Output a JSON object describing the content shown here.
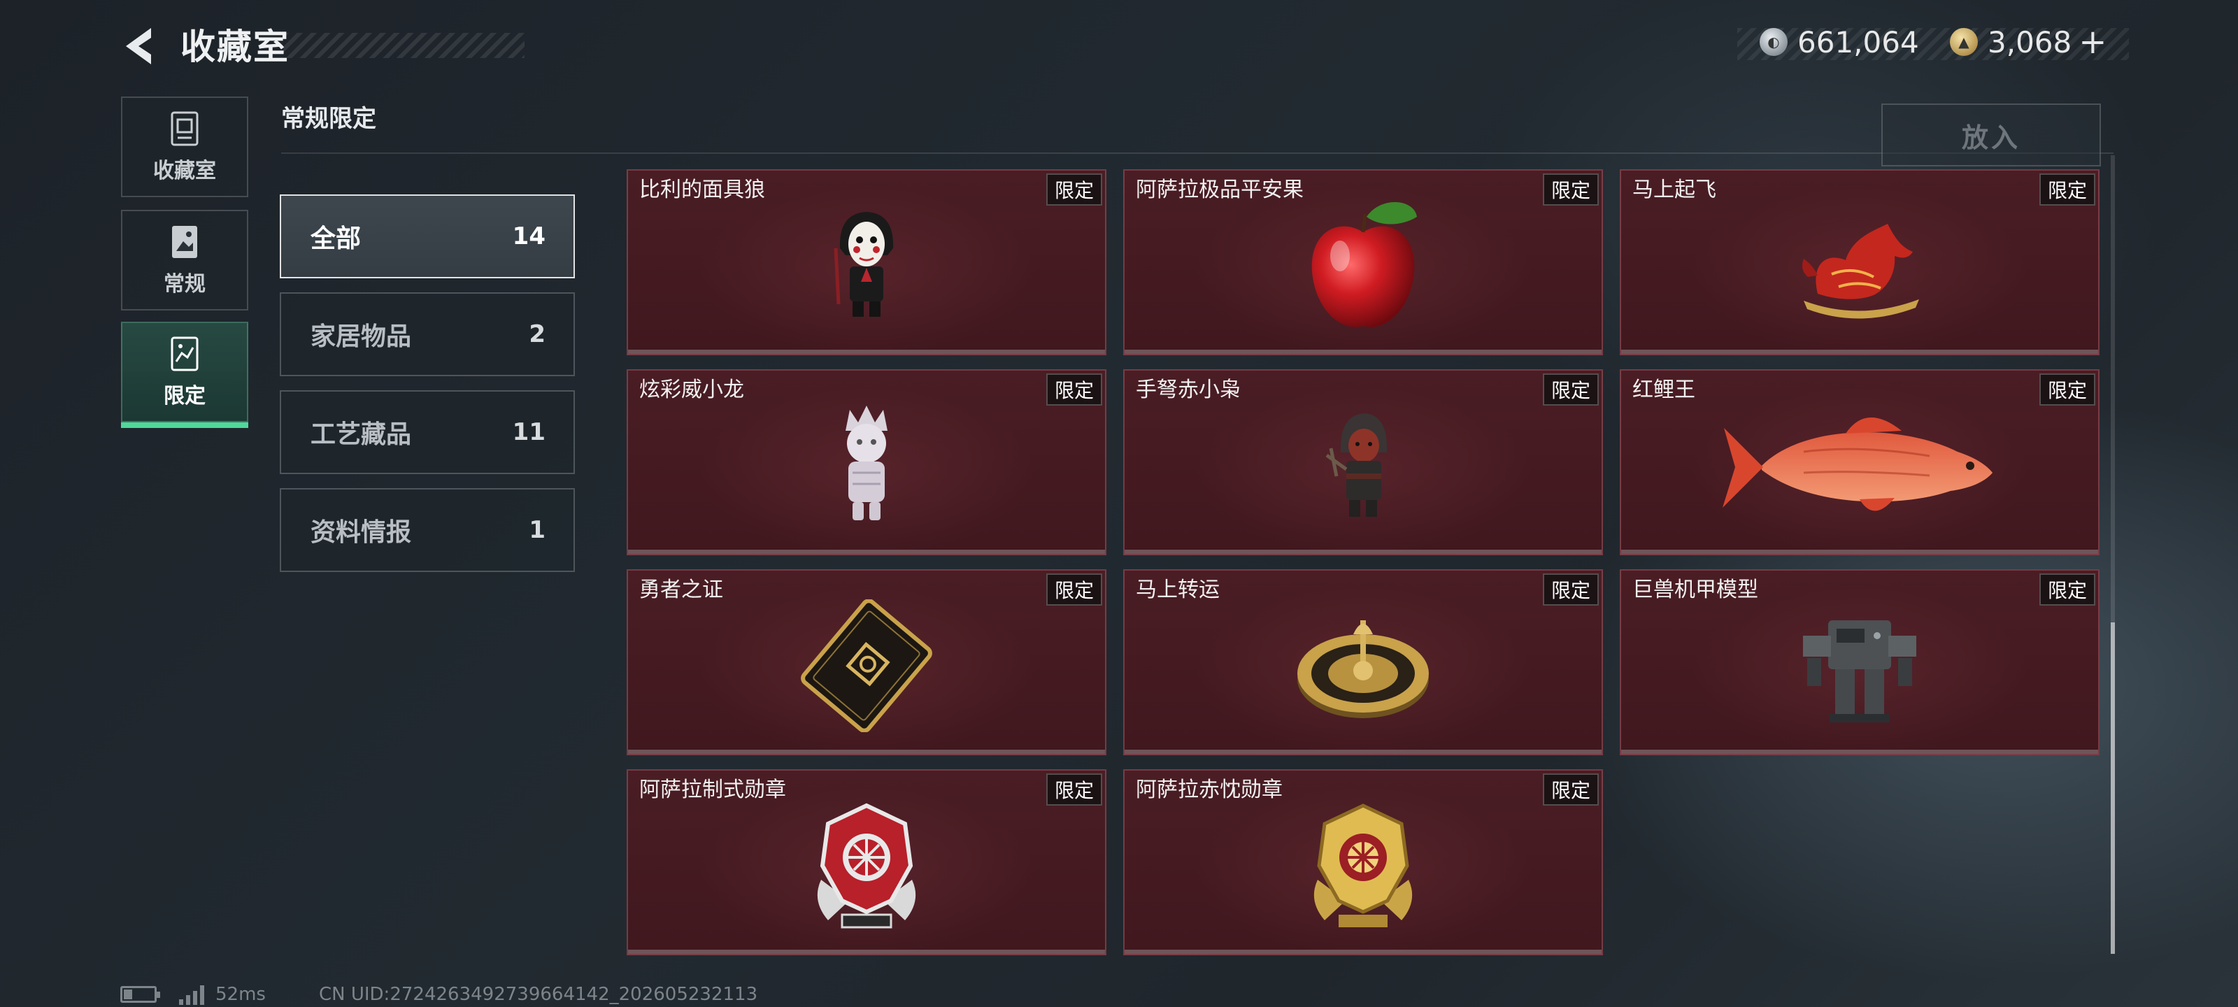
{
  "header": {
    "title": "收藏室",
    "currency_silver": "661,064",
    "currency_gold": "3,068",
    "plus": "+"
  },
  "nav": [
    {
      "label": "收藏室",
      "icon": "collection-icon"
    },
    {
      "label": "常规",
      "icon": "regular-icon"
    },
    {
      "label": "限定",
      "icon": "limited-icon",
      "active": true
    }
  ],
  "section": {
    "title": "常规限定",
    "put_button": "放入"
  },
  "categories": [
    {
      "name": "全部",
      "count": "14",
      "active": true
    },
    {
      "name": "家居物品",
      "count": "2"
    },
    {
      "name": "工艺藏品",
      "count": "11"
    },
    {
      "name": "资料情报",
      "count": "1"
    }
  ],
  "items": [
    {
      "name": "比利的面具狼",
      "tag": "限定",
      "icon": "puppet-figure-icon"
    },
    {
      "name": "阿萨拉极品平安果",
      "tag": "限定",
      "icon": "apple-icon"
    },
    {
      "name": "马上起飞",
      "tag": "限定",
      "icon": "red-horse-icon"
    },
    {
      "name": "炫彩威小龙",
      "tag": "限定",
      "icon": "white-figure-icon"
    },
    {
      "name": "手弩赤小枭",
      "tag": "限定",
      "icon": "hooded-figure-icon"
    },
    {
      "name": "红鲤王",
      "tag": "限定",
      "icon": "red-carp-icon"
    },
    {
      "name": "勇者之证",
      "tag": "限定",
      "icon": "card-icon"
    },
    {
      "name": "马上转运",
      "tag": "限定",
      "icon": "golden-compass-icon"
    },
    {
      "name": "巨兽机甲模型",
      "tag": "限定",
      "icon": "mech-model-icon"
    },
    {
      "name": "阿萨拉制式勋章",
      "tag": "限定",
      "icon": "red-medal-icon"
    },
    {
      "name": "阿萨拉赤忱勋章",
      "tag": "限定",
      "icon": "gold-medal-icon"
    }
  ],
  "footer": {
    "ping": "52ms",
    "uid": "CN UID:2724263492739664142_202605232113"
  },
  "colors": {
    "accent_green": "#4fd89a",
    "card_bg": "#4a1d24"
  }
}
